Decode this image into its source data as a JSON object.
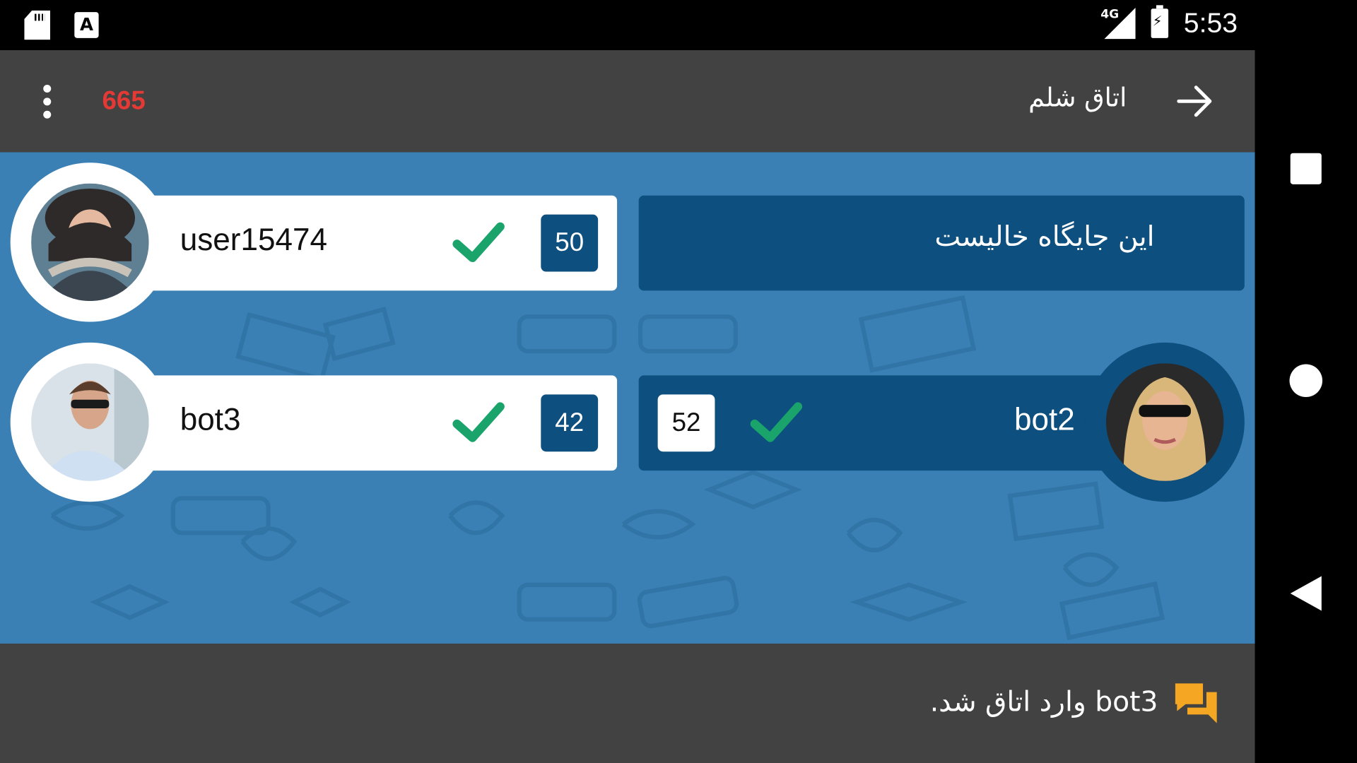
{
  "status_bar": {
    "time": "5:53",
    "network": "4G",
    "icons": [
      "sd-card-icon",
      "keyboard-a-icon",
      "signal-icon",
      "battery-charging-icon"
    ]
  },
  "app_bar": {
    "coins": "665",
    "room_title": "اتاق شلم",
    "icons": [
      "overflow-menu-icon",
      "back-arrow-icon"
    ]
  },
  "seats": {
    "top_left": {
      "name": "user15474",
      "score": "50",
      "ready": true
    },
    "top_right": {
      "empty_text": "این جایگاه خالیست"
    },
    "bottom_left": {
      "name": "bot3",
      "score": "42",
      "ready": true
    },
    "bottom_right": {
      "name": "bot2",
      "score": "52",
      "ready": true
    }
  },
  "bottom_bar": {
    "message": "bot3 وارد اتاق شد.",
    "icon": "chat-bubbles-icon"
  },
  "colors": {
    "accent_red": "#e53935",
    "check_green": "#1aa36b",
    "seat_dark": "#0d4f7e",
    "table_blue": "#3a80b5",
    "bar_gray": "#424242",
    "chat_orange": "#f5a623"
  }
}
